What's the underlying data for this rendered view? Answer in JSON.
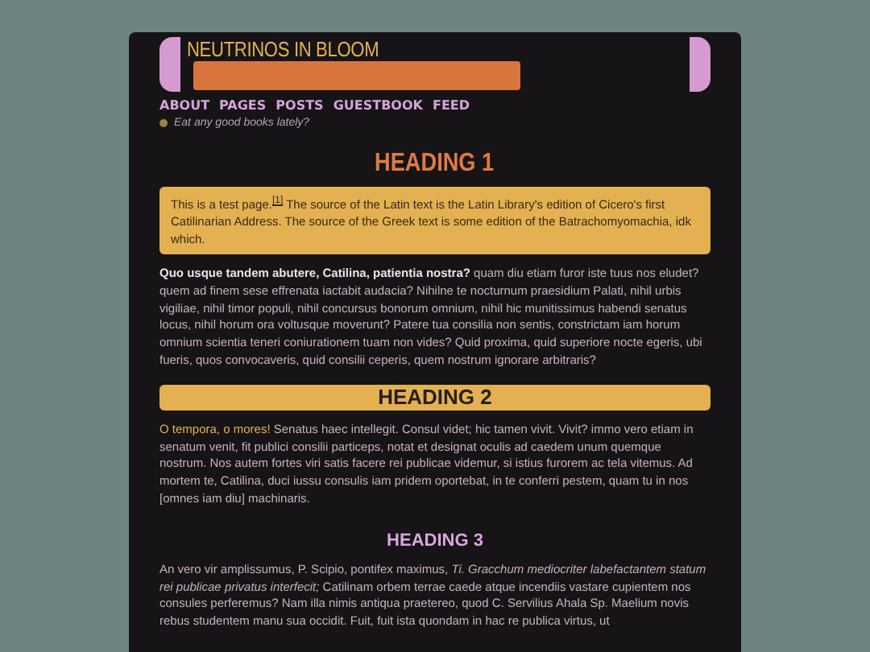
{
  "site": {
    "title": "NEUTRINOS IN BLOOM"
  },
  "nav": [
    {
      "label": "ABOUT"
    },
    {
      "label": "PAGES"
    },
    {
      "label": "POSTS"
    },
    {
      "label": "GUESTBOOK"
    },
    {
      "label": "FEED"
    }
  ],
  "tagline": "Eat any good books lately?",
  "content": [
    {
      "kind": "heading1",
      "text": "HEADING 1"
    },
    {
      "kind": "callout",
      "text": "This is a test page.$^{[1]}$ The source of the Latin text is the Latin Library's edition of Cicero's first Catilinarian Address. The source of the Greek text is some edition of the Batrachomyomachia, idk which."
    },
    {
      "kind": "paragraph",
      "text": "**Quo usque tandem abutere, Catilina, patientia nostra?** quam diu etiam furor iste tuus nos eludet? quem ad finem sese effrenata iactabit audacia? Nihilne te nocturnum praesidium Palati, nihil urbis vigiliae, nihil timor populi, nihil concursus bonorum omnium, nihil hic munitissimus habendi senatus locus, nihil horum ora voltusque moverunt? Patere tua consilia non sentis, constrictam iam horum omnium scientia teneri coniurationem tuam non vides? Quid proxima, quid superiore nocte egeris, ubi fueris, quos convocaveris, quid consilii ceperis, quem nostrum ignorare arbitraris?"
    },
    {
      "kind": "heading2",
      "text": "HEADING 2"
    },
    {
      "kind": "paragraph",
      "link": "O tempora, o mores!",
      "text": " Senatus haec intellegit. Consul videt; hic tamen vivit. Vivit? immo vero etiam in senatum venit, fit publici consilii particeps, notat et designat oculis ad caedem unum quemque nostrum. Nos autem fortes viri satis facere rei publicae videmur, si istius furorem ac tela vitemus. Ad mortem te, Catilina, duci iussu consulis iam pridem oportebat, in te conferri pestem, quam tu in nos [omnes iam diu] machinaris."
    },
    {
      "kind": "heading3",
      "text": "HEADING 3"
    },
    {
      "kind": "paragraph",
      "text": "An vero vir amplissumus, P. Scipio, pontifex maximus, *Ti. Gracchum mediocriter labefactantem statum rei publicae privatus interfecit;* Catilinam orbem terrae caede atque incendiis vastare cupientem nos consules perferemus? Nam illa nimis antiqua praetereo, quod C. Servilius Ahala Sp. Maelium novis rebus studentem manu sua occidit. Fuit, fuit ista quondam in hac re publica virtus, ut"
    }
  ]
}
